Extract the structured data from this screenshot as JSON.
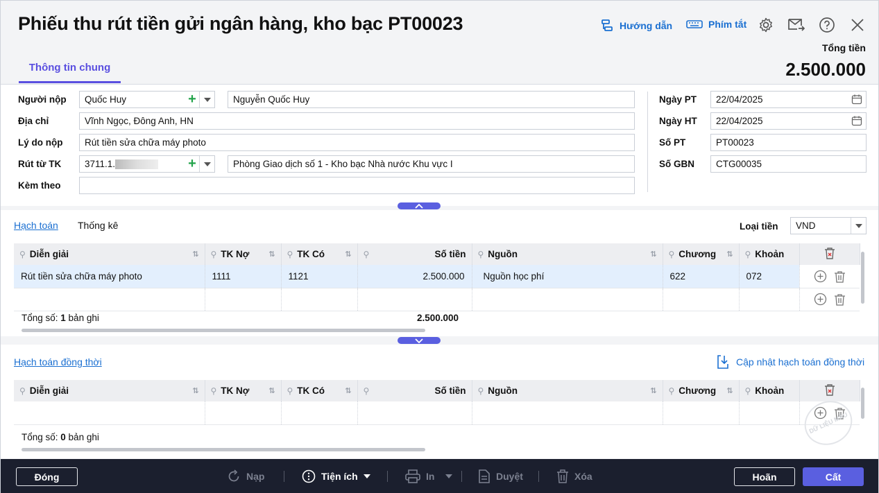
{
  "header": {
    "title": "Phiếu thu rút tiền gửi ngân hàng, kho bạc PT00023",
    "guide_label": "Hướng dẫn",
    "shortcut_label": "Phím tắt",
    "total_label": "Tổng tiền",
    "total_value": "2.500.000",
    "tab_general": "Thông tin chung"
  },
  "form": {
    "payer_label": "Người nộp",
    "payer_code": "Quốc Huy",
    "payer_name": "Nguyễn Quốc Huy",
    "address_label": "Địa chỉ",
    "address": "Vĩnh Ngọc, Đông Anh, HN",
    "reason_label": "Lý do nộp",
    "reason": "Rút tiền sửa chữa máy photo",
    "account_label": "Rút từ TK",
    "account_code": "3711.1.",
    "account_name": "Phòng Giao dịch số 1 - Kho bạc Nhà nước Khu vực I",
    "attach_label": "Kèm theo",
    "attach": "",
    "date_pt_label": "Ngày PT",
    "date_pt": "22/04/2025",
    "date_ht_label": "Ngày HT",
    "date_ht": "22/04/2025",
    "so_pt_label": "Số PT",
    "so_pt": "PT00023",
    "so_gbn_label": "Số GBN",
    "so_gbn": "CTG00035"
  },
  "accounting": {
    "tab_accounting": "Hạch toán",
    "tab_stats": "Thống kê",
    "currency_label": "Loại tiền",
    "currency": "VND",
    "columns": [
      "Diễn giải",
      "TK Nợ",
      "TK Có",
      "Số tiền",
      "Nguồn",
      "Chương",
      "Khoản"
    ],
    "rows": [
      {
        "dien_giai": "Rút tiền sửa chữa máy photo",
        "tk_no": "1111",
        "tk_co": "1121",
        "so_tien": "2.500.000",
        "nguon": "Nguồn học phí",
        "chuong": "622",
        "khoan": "072"
      }
    ],
    "total_prefix": "Tổng số: ",
    "total_count": "1",
    "total_suffix": " bản ghi",
    "total_amount": "2.500.000"
  },
  "concurrent": {
    "title": "Hạch toán đồng thời",
    "update_label": "Cập nhật hạch toán đồng thời",
    "columns": [
      "Diễn giải",
      "TK Nợ",
      "TK Có",
      "Số tiền",
      "Nguồn",
      "Chương",
      "Khoản"
    ],
    "total_prefix": "Tổng số: ",
    "total_count": "0",
    "total_suffix": " bản ghi",
    "watermark": "DỮ LIỆU MẪU"
  },
  "toolbar": {
    "close": "Đóng",
    "reload": "Nạp",
    "utilities": "Tiện ích",
    "print": "In",
    "approve": "Duyệt",
    "delete": "Xóa",
    "cancel": "Hoãn",
    "save": "Cất"
  },
  "colors": {
    "accent": "#5a5fe0",
    "link": "#1a6fd1",
    "toolbar_bg": "#1b1f2e"
  }
}
